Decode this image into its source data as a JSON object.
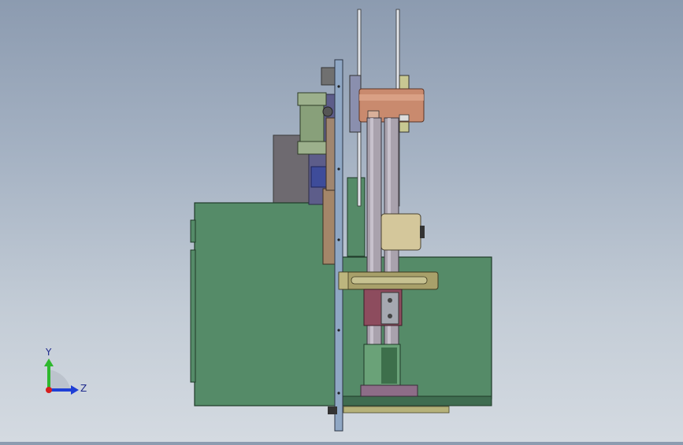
{
  "viewport": {
    "background_top": "#8c9bb0",
    "background_bottom": "#d4dae1"
  },
  "model": {
    "colors": {
      "green_panel": "#558b68",
      "plate_blue": "#8fa7c4",
      "rod_gray": "#a9a2ad",
      "copper": "#c98a6e",
      "bracket_olive": "#a8a06a",
      "block_red": "#8d4c5e",
      "motor_tan": "#d4c79b",
      "dark_gray": "#6e6a70"
    }
  },
  "triad": {
    "x_label": "",
    "y_label": "Y",
    "z_label": "Z",
    "y_color": "#2eb82e",
    "z_color": "#1f3fd6",
    "origin_color": "#d61f1f"
  }
}
